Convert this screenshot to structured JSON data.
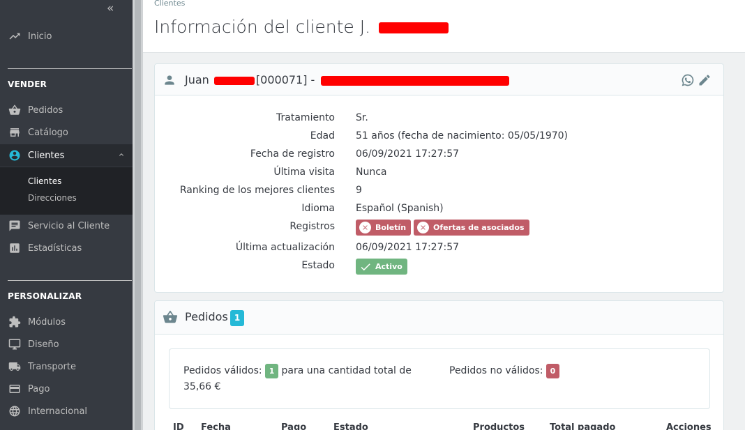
{
  "sidebar": {
    "collapse_icon": "double-chevron-left-icon",
    "inicio": "Inicio",
    "section_vender": "VENDER",
    "pedidos": "Pedidos",
    "catalogo": "Catálogo",
    "clientes": "Clientes",
    "sub_clientes": "Clientes",
    "sub_direcciones": "Direcciones",
    "servicio": "Servicio al Cliente",
    "estadisticas": "Estadísticas",
    "section_personalizar": "PERSONALIZAR",
    "modulos": "Módulos",
    "diseno": "Diseño",
    "transporte": "Transporte",
    "pago": "Pago",
    "internacional": "Internacional"
  },
  "header": {
    "breadcrumb": "Clientes",
    "title": "Información del cliente J."
  },
  "customer": {
    "name_prefix": "Juan",
    "id_text": "[000071] -",
    "fields": {
      "tratamiento_label": "Tratamiento",
      "tratamiento": "Sr.",
      "edad_label": "Edad",
      "edad": "51 años (fecha de nacimiento: 05/05/1970)",
      "registro_label": "Fecha de registro",
      "registro": "06/09/2021 17:27:57",
      "visita_label": "Última visita",
      "visita": "Nunca",
      "ranking_label": "Ranking de los mejores clientes",
      "ranking": "9",
      "idioma_label": "Idioma",
      "idioma": "Español (Spanish)",
      "registros_label": "Registros",
      "boletin": "Boletín",
      "ofertas": "Ofertas de asociados",
      "actualizacion_label": "Última actualización",
      "actualizacion": "06/09/2021 17:27:57",
      "estado_label": "Estado",
      "estado": "Activo"
    }
  },
  "orders": {
    "title": "Pedidos",
    "count": "1",
    "valid_label": "Pedidos válidos:",
    "valid_count": "1",
    "valid_total_text": "para una cantidad total de",
    "valid_total": "35,66 €",
    "invalid_label": "Pedidos no válidos:",
    "invalid_count": "0",
    "columns": [
      "ID",
      "Fecha",
      "Pago",
      "Estado",
      "Productos",
      "Total pagado",
      "Acciones"
    ]
  },
  "colors": {
    "sidebar_bg": "#363a41",
    "accent": "#25b9d7",
    "danger": "#c05c67",
    "success": "#70b580"
  }
}
